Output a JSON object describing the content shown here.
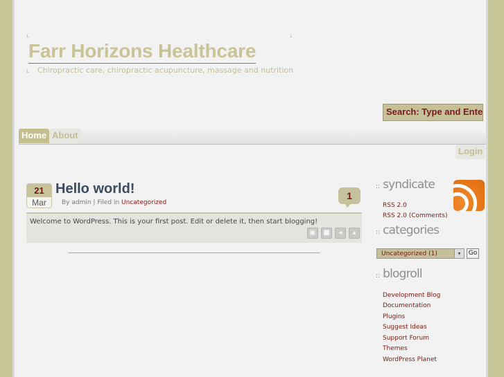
{
  "site": {
    "title": "Farr Horizons Healthcare",
    "description": "Chiropractic care, chiropractic acupuncture, massage and nutrition"
  },
  "search": {
    "value": "Search: Type and Enter"
  },
  "nav": {
    "tabs": [
      {
        "label": "Home",
        "active": true
      },
      {
        "label": "About",
        "active": false
      }
    ],
    "login": "Login"
  },
  "post": {
    "day": "21",
    "month": "Mar",
    "title": "Hello world!",
    "meta_prefix": "By admin | Filed in",
    "category": "Uncategorized",
    "comments": "1",
    "body": "Welcome to WordPress. This is your first post. Edit or delete it, then start blogging!",
    "action_icons": [
      "print-icon",
      "email-icon",
      "back-icon",
      "top-icon"
    ]
  },
  "sidebar": {
    "syndicate": {
      "heading": "syndicate",
      "links": [
        "RSS 2.0",
        "RSS 2.0 (Comments)"
      ]
    },
    "categories": {
      "heading": "categories",
      "selected": "Uncategorized  (1)",
      "go": "Go"
    },
    "blogroll": {
      "heading": "blogroll",
      "links": [
        "Development Blog",
        "Documentation",
        "Plugins",
        "Suggest Ideas",
        "Support Forum",
        "Themes",
        "WordPress Planet"
      ]
    },
    "heading_prefix": "::"
  },
  "colors": {
    "accent": "#c8c39a",
    "link": "#7a1a10",
    "title_text": "#3a4a60",
    "rss": "#e06a10"
  }
}
